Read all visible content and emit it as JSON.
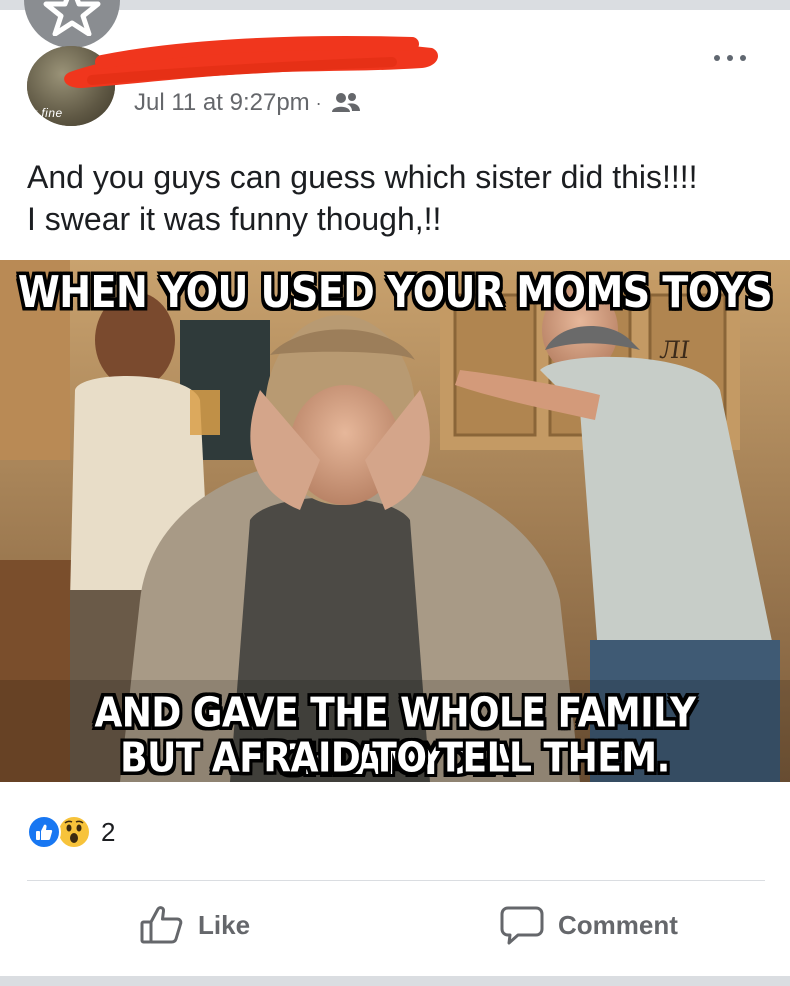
{
  "post": {
    "timestamp": "Jul 11 at 9:27pm",
    "separator": "·",
    "audience_icon": "friends-icon",
    "avatar_text": "y fine",
    "text_line1": "And you guys can guess which sister did this!!!!",
    "text_line2": "I swear it was funny though,!!"
  },
  "meme": {
    "caption_top": "WHEN YOU USED YOUR MOMS TOYS",
    "caption_bottom_line1": "AND GAVE THE WHOLE FAMILY CHLAMYDIA",
    "caption_bottom_line2": "BUT AFRAID TO TELL THEM.",
    "watermark": "ЛI"
  },
  "reactions": {
    "icons": [
      "like-reaction-icon",
      "wow-reaction-icon"
    ],
    "count": "2"
  },
  "actions": {
    "like_label": "Like",
    "comment_label": "Comment"
  },
  "colors": {
    "facebook_blue": "#1877f2",
    "redaction_red": "#f0361d",
    "secondary_text": "#65676b"
  }
}
